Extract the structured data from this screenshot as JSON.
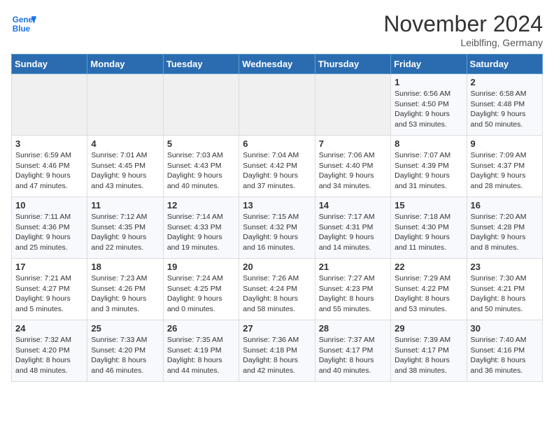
{
  "header": {
    "logo_line1": "General",
    "logo_line2": "Blue",
    "month": "November 2024",
    "location": "Leiblfing, Germany"
  },
  "days_of_week": [
    "Sunday",
    "Monday",
    "Tuesday",
    "Wednesday",
    "Thursday",
    "Friday",
    "Saturday"
  ],
  "weeks": [
    [
      {
        "day": "",
        "info": ""
      },
      {
        "day": "",
        "info": ""
      },
      {
        "day": "",
        "info": ""
      },
      {
        "day": "",
        "info": ""
      },
      {
        "day": "",
        "info": ""
      },
      {
        "day": "1",
        "info": "Sunrise: 6:56 AM\nSunset: 4:50 PM\nDaylight: 9 hours and 53 minutes."
      },
      {
        "day": "2",
        "info": "Sunrise: 6:58 AM\nSunset: 4:48 PM\nDaylight: 9 hours and 50 minutes."
      }
    ],
    [
      {
        "day": "3",
        "info": "Sunrise: 6:59 AM\nSunset: 4:46 PM\nDaylight: 9 hours and 47 minutes."
      },
      {
        "day": "4",
        "info": "Sunrise: 7:01 AM\nSunset: 4:45 PM\nDaylight: 9 hours and 43 minutes."
      },
      {
        "day": "5",
        "info": "Sunrise: 7:03 AM\nSunset: 4:43 PM\nDaylight: 9 hours and 40 minutes."
      },
      {
        "day": "6",
        "info": "Sunrise: 7:04 AM\nSunset: 4:42 PM\nDaylight: 9 hours and 37 minutes."
      },
      {
        "day": "7",
        "info": "Sunrise: 7:06 AM\nSunset: 4:40 PM\nDaylight: 9 hours and 34 minutes."
      },
      {
        "day": "8",
        "info": "Sunrise: 7:07 AM\nSunset: 4:39 PM\nDaylight: 9 hours and 31 minutes."
      },
      {
        "day": "9",
        "info": "Sunrise: 7:09 AM\nSunset: 4:37 PM\nDaylight: 9 hours and 28 minutes."
      }
    ],
    [
      {
        "day": "10",
        "info": "Sunrise: 7:11 AM\nSunset: 4:36 PM\nDaylight: 9 hours and 25 minutes."
      },
      {
        "day": "11",
        "info": "Sunrise: 7:12 AM\nSunset: 4:35 PM\nDaylight: 9 hours and 22 minutes."
      },
      {
        "day": "12",
        "info": "Sunrise: 7:14 AM\nSunset: 4:33 PM\nDaylight: 9 hours and 19 minutes."
      },
      {
        "day": "13",
        "info": "Sunrise: 7:15 AM\nSunset: 4:32 PM\nDaylight: 9 hours and 16 minutes."
      },
      {
        "day": "14",
        "info": "Sunrise: 7:17 AM\nSunset: 4:31 PM\nDaylight: 9 hours and 14 minutes."
      },
      {
        "day": "15",
        "info": "Sunrise: 7:18 AM\nSunset: 4:30 PM\nDaylight: 9 hours and 11 minutes."
      },
      {
        "day": "16",
        "info": "Sunrise: 7:20 AM\nSunset: 4:28 PM\nDaylight: 9 hours and 8 minutes."
      }
    ],
    [
      {
        "day": "17",
        "info": "Sunrise: 7:21 AM\nSunset: 4:27 PM\nDaylight: 9 hours and 5 minutes."
      },
      {
        "day": "18",
        "info": "Sunrise: 7:23 AM\nSunset: 4:26 PM\nDaylight: 9 hours and 3 minutes."
      },
      {
        "day": "19",
        "info": "Sunrise: 7:24 AM\nSunset: 4:25 PM\nDaylight: 9 hours and 0 minutes."
      },
      {
        "day": "20",
        "info": "Sunrise: 7:26 AM\nSunset: 4:24 PM\nDaylight: 8 hours and 58 minutes."
      },
      {
        "day": "21",
        "info": "Sunrise: 7:27 AM\nSunset: 4:23 PM\nDaylight: 8 hours and 55 minutes."
      },
      {
        "day": "22",
        "info": "Sunrise: 7:29 AM\nSunset: 4:22 PM\nDaylight: 8 hours and 53 minutes."
      },
      {
        "day": "23",
        "info": "Sunrise: 7:30 AM\nSunset: 4:21 PM\nDaylight: 8 hours and 50 minutes."
      }
    ],
    [
      {
        "day": "24",
        "info": "Sunrise: 7:32 AM\nSunset: 4:20 PM\nDaylight: 8 hours and 48 minutes."
      },
      {
        "day": "25",
        "info": "Sunrise: 7:33 AM\nSunset: 4:20 PM\nDaylight: 8 hours and 46 minutes."
      },
      {
        "day": "26",
        "info": "Sunrise: 7:35 AM\nSunset: 4:19 PM\nDaylight: 8 hours and 44 minutes."
      },
      {
        "day": "27",
        "info": "Sunrise: 7:36 AM\nSunset: 4:18 PM\nDaylight: 8 hours and 42 minutes."
      },
      {
        "day": "28",
        "info": "Sunrise: 7:37 AM\nSunset: 4:17 PM\nDaylight: 8 hours and 40 minutes."
      },
      {
        "day": "29",
        "info": "Sunrise: 7:39 AM\nSunset: 4:17 PM\nDaylight: 8 hours and 38 minutes."
      },
      {
        "day": "30",
        "info": "Sunrise: 7:40 AM\nSunset: 4:16 PM\nDaylight: 8 hours and 36 minutes."
      }
    ]
  ]
}
